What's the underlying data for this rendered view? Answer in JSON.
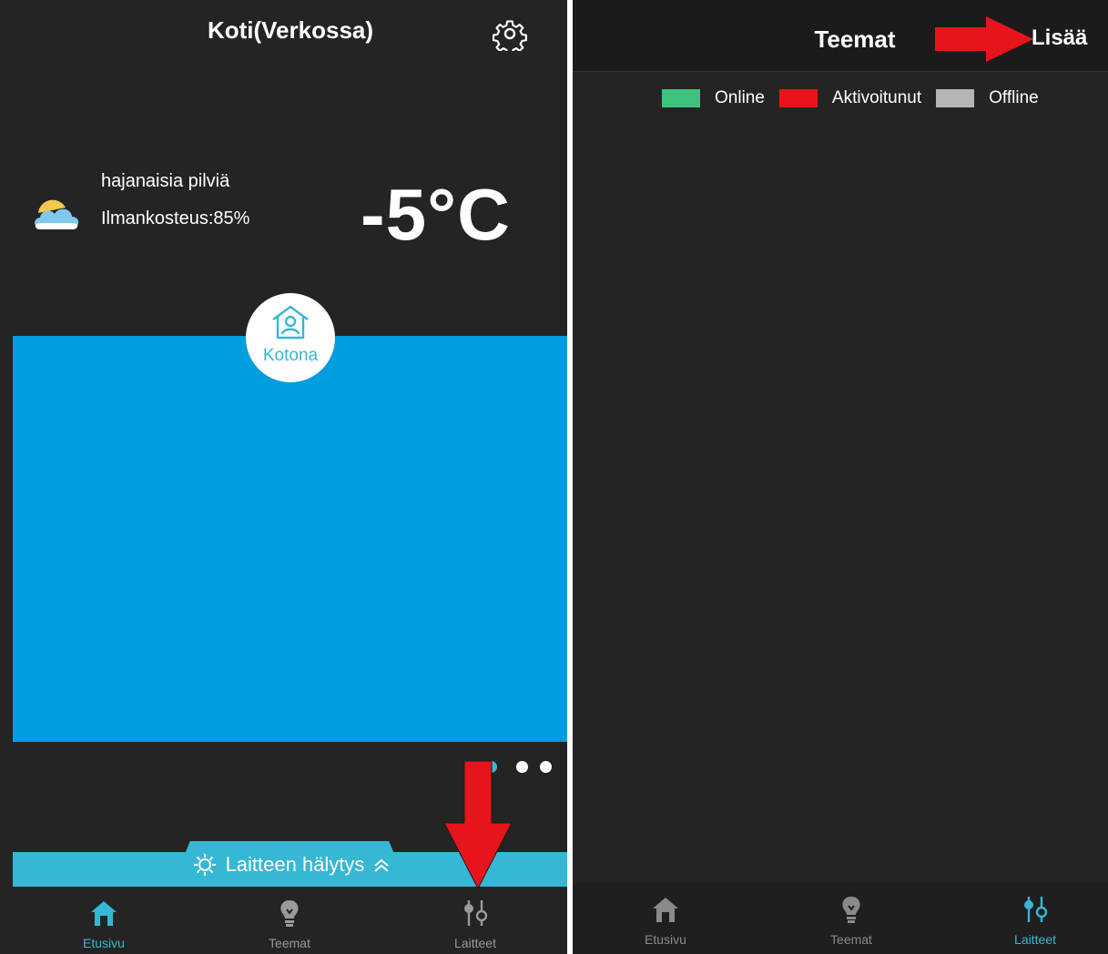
{
  "colors": {
    "background": "#242424",
    "accent": "#36b7d4",
    "panel_blue": "#009ddf",
    "online": "#3cc47e",
    "activated": "#e8141b",
    "offline": "#b5b5b5",
    "annotation_arrow": "#e8141b"
  },
  "left_screen": {
    "title": "Koti(Verkossa)",
    "settings_icon": "gear-icon",
    "weather": {
      "icon": "partly-cloudy-icon",
      "description": "hajanaisia pilviä",
      "humidity": "Ilmankosteus:85%",
      "temperature": "-5°C"
    },
    "mode": {
      "icon": "home-person-icon",
      "label": "Kotona"
    },
    "carousel": {
      "pages": 3,
      "active_index": 0
    },
    "alarm_bar": {
      "icon": "bulb-ray-icon",
      "label": "Laitteen hälytys",
      "chevron": "chevron-up-icon"
    },
    "bottom_nav": [
      {
        "label": "Etusivu",
        "icon": "home-icon",
        "active": true
      },
      {
        "label": "Teemat",
        "icon": "lightbulb-icon",
        "active": false
      },
      {
        "label": "Laitteet",
        "icon": "sliders-icon",
        "active": false
      }
    ]
  },
  "right_screen": {
    "title": "Teemat",
    "add_button": "Lisää",
    "legend": [
      {
        "label": "Online",
        "color": "#3cc47e"
      },
      {
        "label": "Aktivoitunut",
        "color": "#e8141b"
      },
      {
        "label": "Offline",
        "color": "#b5b5b5"
      }
    ],
    "bottom_nav": [
      {
        "label": "Etusivu",
        "icon": "home-icon",
        "active": false
      },
      {
        "label": "Teemat",
        "icon": "lightbulb-icon",
        "active": false
      },
      {
        "label": "Laitteet",
        "icon": "sliders-icon",
        "active": true
      }
    ]
  }
}
